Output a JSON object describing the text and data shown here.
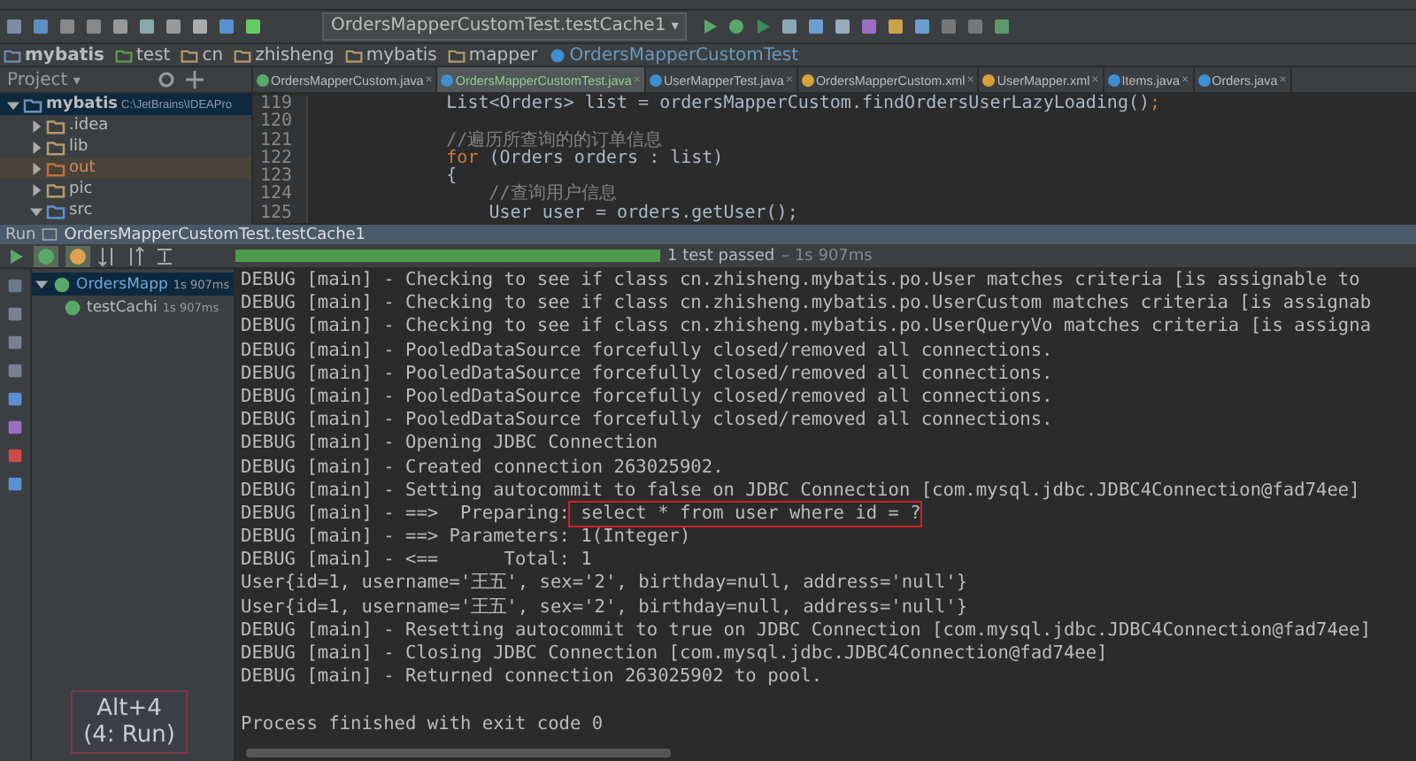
{
  "toolbar": {
    "run_config": "OrdersMapperCustomTest.testCache1",
    "caret": "▾"
  },
  "breadcrumbs": [
    {
      "label": "mybatis",
      "kind": "module"
    },
    {
      "label": "test",
      "kind": "test_folder"
    },
    {
      "label": "cn",
      "kind": "package"
    },
    {
      "label": "zhisheng",
      "kind": "package"
    },
    {
      "label": "mybatis",
      "kind": "package"
    },
    {
      "label": "mapper",
      "kind": "package"
    },
    {
      "label": "OrdersMapperCustomTest",
      "kind": "class"
    }
  ],
  "project_panel": {
    "title": "Project",
    "caret": "▾",
    "tree": [
      {
        "label": "mybatis",
        "path": "C:\\JetBrains\\IDEAPro",
        "kind": "module",
        "expanded": true,
        "children": [
          {
            "label": ".idea",
            "kind": "folder",
            "expanded": false
          },
          {
            "label": "lib",
            "kind": "folder",
            "expanded": false
          },
          {
            "label": "out",
            "kind": "excluded",
            "expanded": false
          },
          {
            "label": "pic",
            "kind": "folder",
            "expanded": false
          },
          {
            "label": "src",
            "kind": "source",
            "expanded": true
          }
        ]
      }
    ]
  },
  "editor_tabs": [
    {
      "label": "OrdersMapperCustom.java",
      "kind": "interface",
      "selected": false,
      "close": "×"
    },
    {
      "label": "OrdersMapperCustomTest.java",
      "kind": "class",
      "selected": true,
      "close": "×"
    },
    {
      "label": "UserMapperTest.java",
      "kind": "class",
      "selected": false,
      "close": "×"
    },
    {
      "label": "OrdersMapperCustom.xml",
      "kind": "xml",
      "selected": false,
      "close": "×"
    },
    {
      "label": "UserMapper.xml",
      "kind": "xml",
      "selected": false,
      "close": "×"
    },
    {
      "label": "Items.java",
      "kind": "class",
      "selected": false,
      "close": "×"
    },
    {
      "label": "Orders.java",
      "kind": "class",
      "selected": false,
      "close": "×"
    }
  ],
  "editor": {
    "lines": [
      {
        "number": "119",
        "tokens": [
          {
            "text": "        List<Orders> list = ordersMapperCustom.findOrdersUserLazyLoading()",
            "kind": "plain"
          },
          {
            "text": ";",
            "kind": "keyword"
          }
        ]
      },
      {
        "number": "120"
      },
      {
        "number": "121",
        "tokens": [
          {
            "text": "        //遍历所查询的的订单信息",
            "kind": "comment"
          }
        ]
      },
      {
        "number": "122",
        "tokens": [
          {
            "text": "        for",
            "kind": "keyword"
          },
          {
            "text": " (Orders orders : list)",
            "kind": "plain"
          }
        ]
      },
      {
        "number": "123",
        "tokens": [
          {
            "text": "        {",
            "kind": "plain"
          }
        ]
      },
      {
        "number": "124",
        "tokens": [
          {
            "text": "            //查询用户信息",
            "kind": "comment"
          }
        ]
      },
      {
        "number": "125",
        "tokens": [
          {
            "text": "            User user = orders.getUser();",
            "kind": "plain"
          }
        ]
      }
    ]
  },
  "run_panel": {
    "title": "Run",
    "config": "OrdersMapperCustomTest.testCache1",
    "progress": {
      "level": 1,
      "status": "1 test passed",
      "time": "– 1s 907ms"
    },
    "tests": [
      {
        "label": "OrdersMapp",
        "time": "1s 907ms",
        "passed": true,
        "selected": true,
        "children": [
          {
            "label": "testCachi",
            "time": "1s 907ms",
            "passed": true,
            "selected": false
          }
        ]
      }
    ],
    "console": [
      {
        "text": "DEBUG [main] - Checking to see if class cn.zhisheng.mybatis.po.User matches criteria [is assignable to"
      },
      {
        "text": "DEBUG [main] - Checking to see if class cn.zhisheng.mybatis.po.UserCustom matches criteria [is assignab"
      },
      {
        "text": "DEBUG [main] - Checking to see if class cn.zhisheng.mybatis.po.UserQueryVo matches criteria [is assigna"
      },
      {
        "text": "DEBUG [main] - PooledDataSource forcefully closed/removed all connections."
      },
      {
        "text": "DEBUG [main] - PooledDataSource forcefully closed/removed all connections."
      },
      {
        "text": "DEBUG [main] - PooledDataSource forcefully closed/removed all connections."
      },
      {
        "text": "DEBUG [main] - PooledDataSource forcefully closed/removed all connections."
      },
      {
        "text": "DEBUG [main] - Opening JDBC Connection"
      },
      {
        "text": "DEBUG [main] - Created connection 263025902."
      },
      {
        "text": "DEBUG [main] - Setting autocommit to false on JDBC Connection [com.mysql.jdbc.JDBC4Connection@fad74ee]"
      },
      {
        "text": "DEBUG [main] - ==>  Preparing:",
        "boxed": " select * from user where id = ?"
      },
      {
        "text": "DEBUG [main] - ==> Parameters: 1(Integer)"
      },
      {
        "text": "DEBUG [main] - <==      Total: 1"
      },
      {
        "text": "User{id=1, username='王五', sex='2', birthday=null, address='null'}"
      },
      {
        "text": "User{id=1, username='王五', sex='2', birthday=null, address='null'}"
      },
      {
        "text": "DEBUG [main] - Resetting autocommit to true on JDBC Connection [com.mysql.jdbc.JDBC4Connection@fad74ee]"
      },
      {
        "text": "DEBUG [main] - Closing JDBC Connection [com.mysql.jdbc.JDBC4Connection@fad74ee]"
      },
      {
        "text": "DEBUG [main] - Returned connection 263025902 to pool."
      },
      {
        "text": "Process finished with exit code 0",
        "kind": "exit"
      }
    ]
  },
  "tooltip": {
    "lines": [
      "Alt+4",
      "(4: Run)"
    ]
  }
}
